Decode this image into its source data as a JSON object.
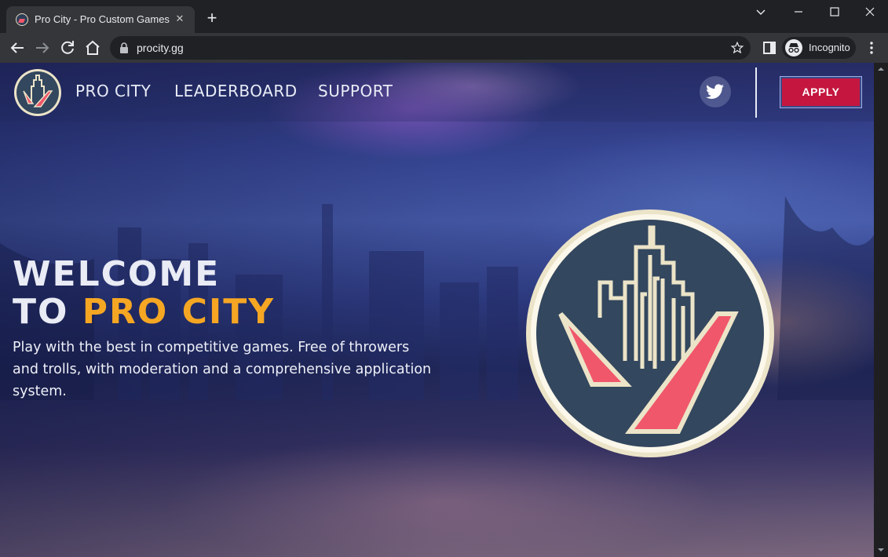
{
  "browser": {
    "tab_title": "Pro City - Pro Custom Games",
    "url": "procity.gg",
    "incognito_label": "Incognito",
    "icons": [
      "tab-favicon",
      "close-icon",
      "plus-icon",
      "chevron-down-icon",
      "minimize-icon",
      "maximize-icon",
      "close-window-icon",
      "back-arrow-icon",
      "forward-arrow-icon",
      "reload-icon",
      "home-icon",
      "lock-icon",
      "star-icon",
      "side-panel-icon",
      "incognito-icon",
      "kebab-menu-icon"
    ]
  },
  "nav": {
    "links": [
      "PRO CITY",
      "LEADERBOARD",
      "SUPPORT"
    ],
    "apply_label": "APPLY",
    "social_icon": "twitter-icon"
  },
  "hero": {
    "headline_line1": "WELCOME",
    "headline_line2_prefix": "TO ",
    "headline_line2_accent": "PRO CITY",
    "subtext": "Play with the best in competitive games. Free of throwers and trolls, with moderation and a comprehensive application system."
  },
  "colors": {
    "accent": "#f5a623",
    "apply_red": "#c4163f",
    "emblem_navy": "#33475e",
    "emblem_pink": "#f0576b",
    "emblem_cream": "#ece4c8"
  }
}
